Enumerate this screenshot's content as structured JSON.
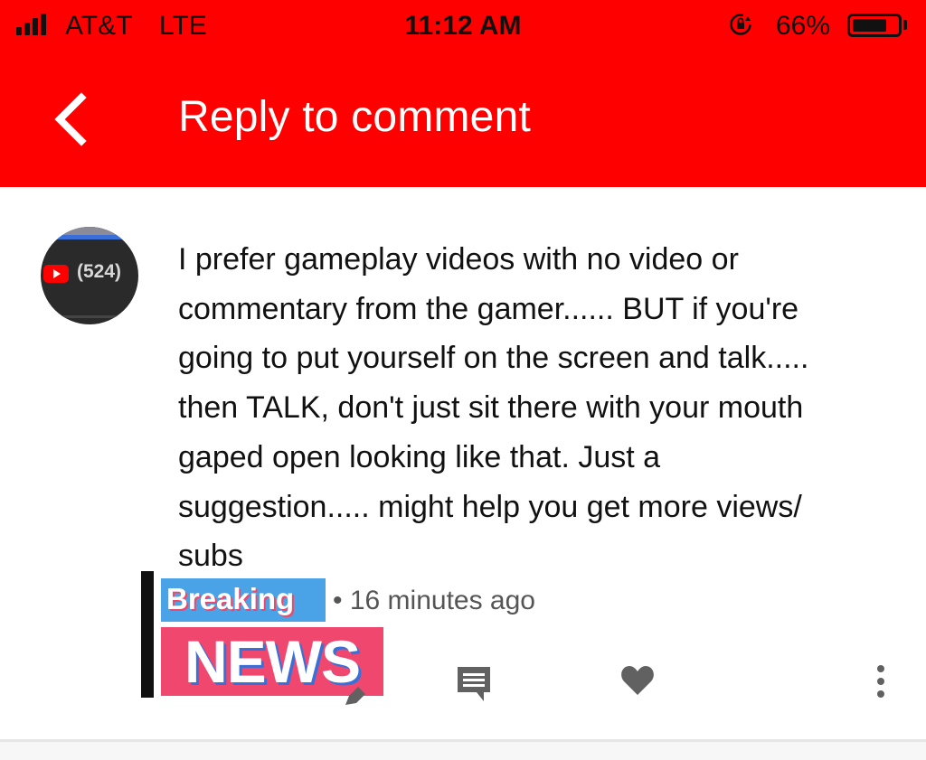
{
  "status_bar": {
    "carrier": "AT&T",
    "network": "LTE",
    "time": "11:12 AM",
    "battery_percent": "66%",
    "battery_level": 0.66,
    "signal_bars": 4
  },
  "app_bar": {
    "title": "Reply to comment",
    "back_icon": "chevron-left-icon"
  },
  "comment": {
    "avatar_count": "(524)",
    "text": "I prefer gameplay videos with no video or\ncommentary from the gamer...... BUT if you're\ngoing to put yourself on the screen and talk.....\nthen TALK, don't just sit there with your mouth\ngaped open looking like that. Just a\nsuggestion..... might help you get more views/\nsubs",
    "timestamp": "• 16 minutes ago",
    "overlay": {
      "top_word": "Breaking",
      "bottom_word": "NEWS"
    }
  },
  "actions": {
    "reply_icon": "comment-icon",
    "like_icon": "heart-icon",
    "more_icon": "more-vertical-icon"
  },
  "colors": {
    "brand_red": "#ff0000",
    "text": "#111111",
    "meta_text": "#555555",
    "icon_gray": "#616161"
  }
}
